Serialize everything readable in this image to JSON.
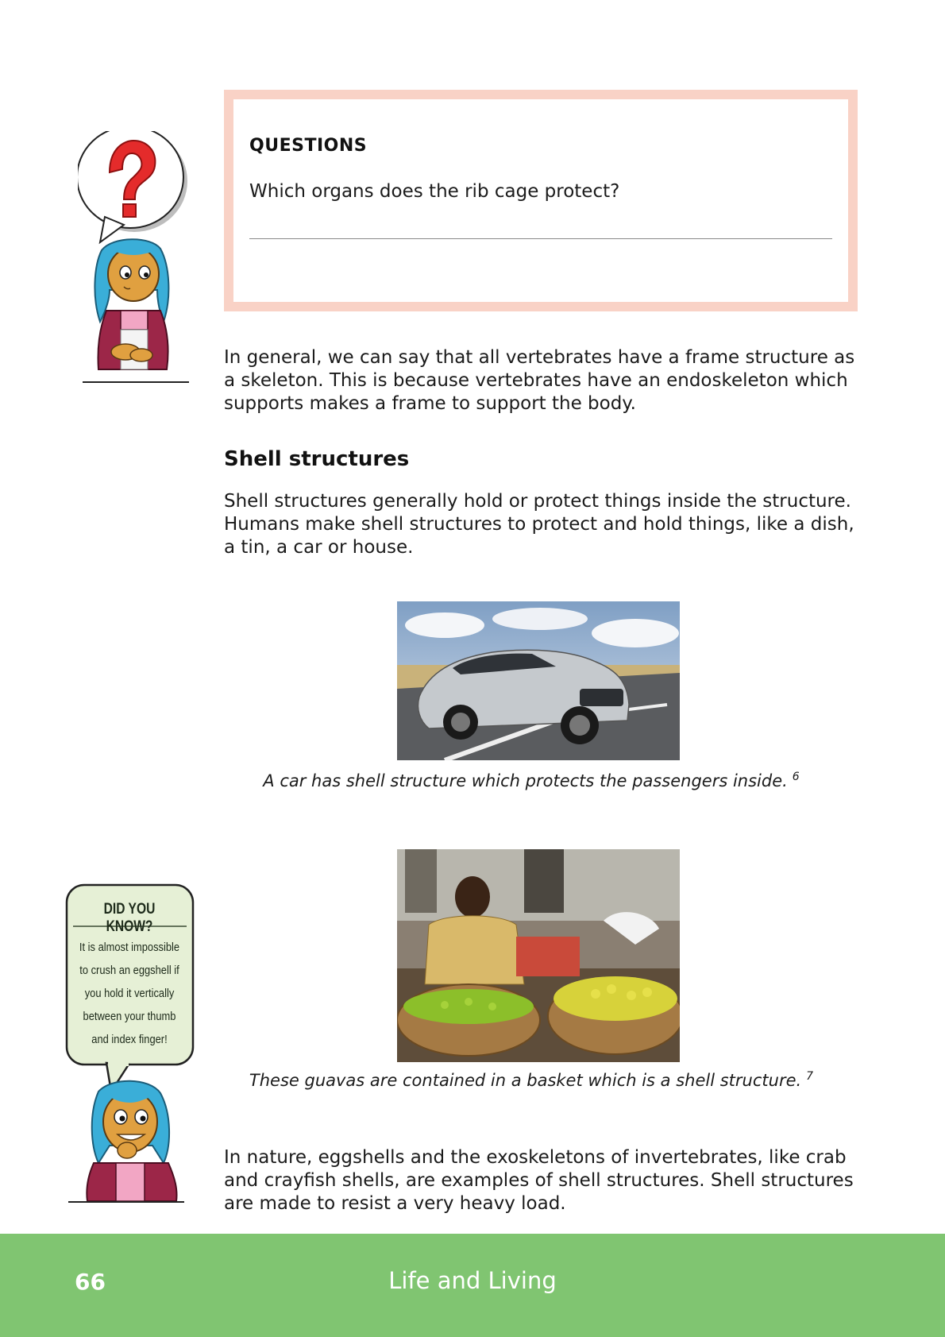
{
  "questions": {
    "title": "QUESTIONS",
    "question": "Which organs does the rib cage protect?"
  },
  "intro_paragraph": "In general, we can say that all vertebrates have a frame structure as a skeleton. This is because vertebrates have an endoskeleton which supports makes a frame to support the body.",
  "section": {
    "heading": "Shell structures",
    "paragraph": "Shell structures generally hold or protect things inside the structure. Humans make shell structures to protect and hold things, like a dish, a tin, a car or house."
  },
  "figures": [
    {
      "caption": "A car has shell structure which protects the passengers inside.",
      "ref": "6"
    },
    {
      "caption": "These guavas are contained in a basket which is a shell structure.",
      "ref": "7"
    }
  ],
  "did_you_know": {
    "title": "DID YOU KNOW?",
    "text": "It is almost impossible to crush an eggshell if you hold it vertically between your thumb and index finger!"
  },
  "closing_paragraph": "In nature, eggshells and the exoskeletons of invertebrates, like crab and crayfish shells, are examples of shell structures. Shell structures are made to resist a very heavy load.",
  "footer": {
    "page_number": "66",
    "title": "Life and Living"
  },
  "colors": {
    "question_border": "#f9d2c6",
    "footer_green": "#80c571",
    "callout_fill": "#e6f0d6"
  },
  "icons": [
    "question-mark-icon"
  ]
}
